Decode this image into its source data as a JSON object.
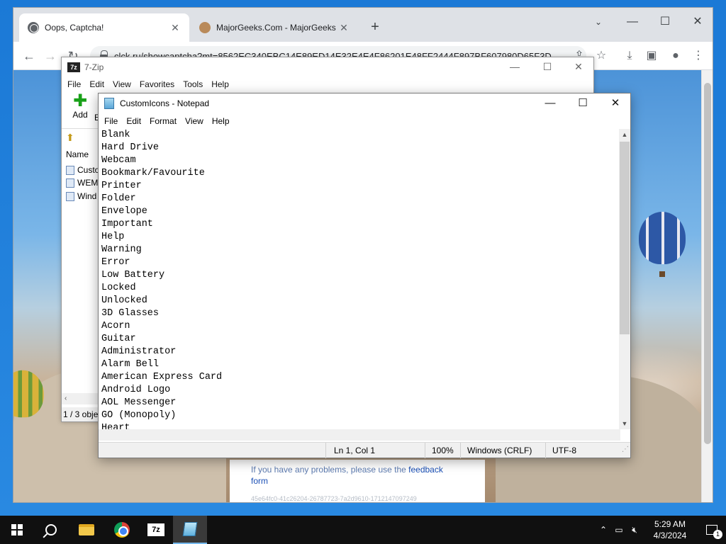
{
  "browser": {
    "tabs": [
      {
        "title": "Oops, Captcha!",
        "icon": "globe-icon",
        "active": true
      },
      {
        "title": "MajorGeeks.Com - MajorGeeks",
        "icon": "majorgeeks-icon",
        "active": false
      }
    ],
    "url": "clck.ru/showcaptcha?mt=8562EC340EBC14E89ED14E32E4E4F86201E48FF2444F897BF607980D65F3D...",
    "page": {
      "feedback_prefix": "If you have any problems, please use the",
      "feedback_link": "feedback",
      "feedback_suffix": "form",
      "hash": "45e64fc0-41c26204-26787723-7a2d9610-1712147097249"
    }
  },
  "sevenzip": {
    "title": "7-Zip",
    "logo": "7z",
    "menu": [
      "File",
      "Edit",
      "View",
      "Favorites",
      "Tools",
      "Help"
    ],
    "add_label": "Add",
    "extra_label": "E",
    "list_header": "Name",
    "rows": [
      "Custo",
      "WEM",
      "Wind"
    ],
    "status": "1 / 3 obje"
  },
  "notepad": {
    "title": "CustomIcons - Notepad",
    "menu": [
      "File",
      "Edit",
      "Format",
      "View",
      "Help"
    ],
    "lines": [
      "Blank",
      "Hard Drive",
      "Webcam",
      "Bookmark/Favourite",
      "Printer",
      "Folder",
      "Envelope",
      "Important",
      "Help",
      "Warning",
      "Error",
      "Low Battery",
      "Locked",
      "Unlocked",
      "3D Glasses",
      "Acorn",
      "Guitar",
      "Administrator",
      "Alarm Bell",
      "American Express Card",
      "Android Logo",
      "AOL Messenger",
      "GO (Monopoly)",
      "Heart"
    ],
    "status": {
      "position": "Ln 1, Col 1",
      "zoom": "100%",
      "line_ending": "Windows (CRLF)",
      "encoding": "UTF-8"
    }
  },
  "taskbar": {
    "sevenzip_label": "7z",
    "clock_time": "5:29 AM",
    "clock_date": "4/3/2024",
    "notification_count": "1"
  }
}
